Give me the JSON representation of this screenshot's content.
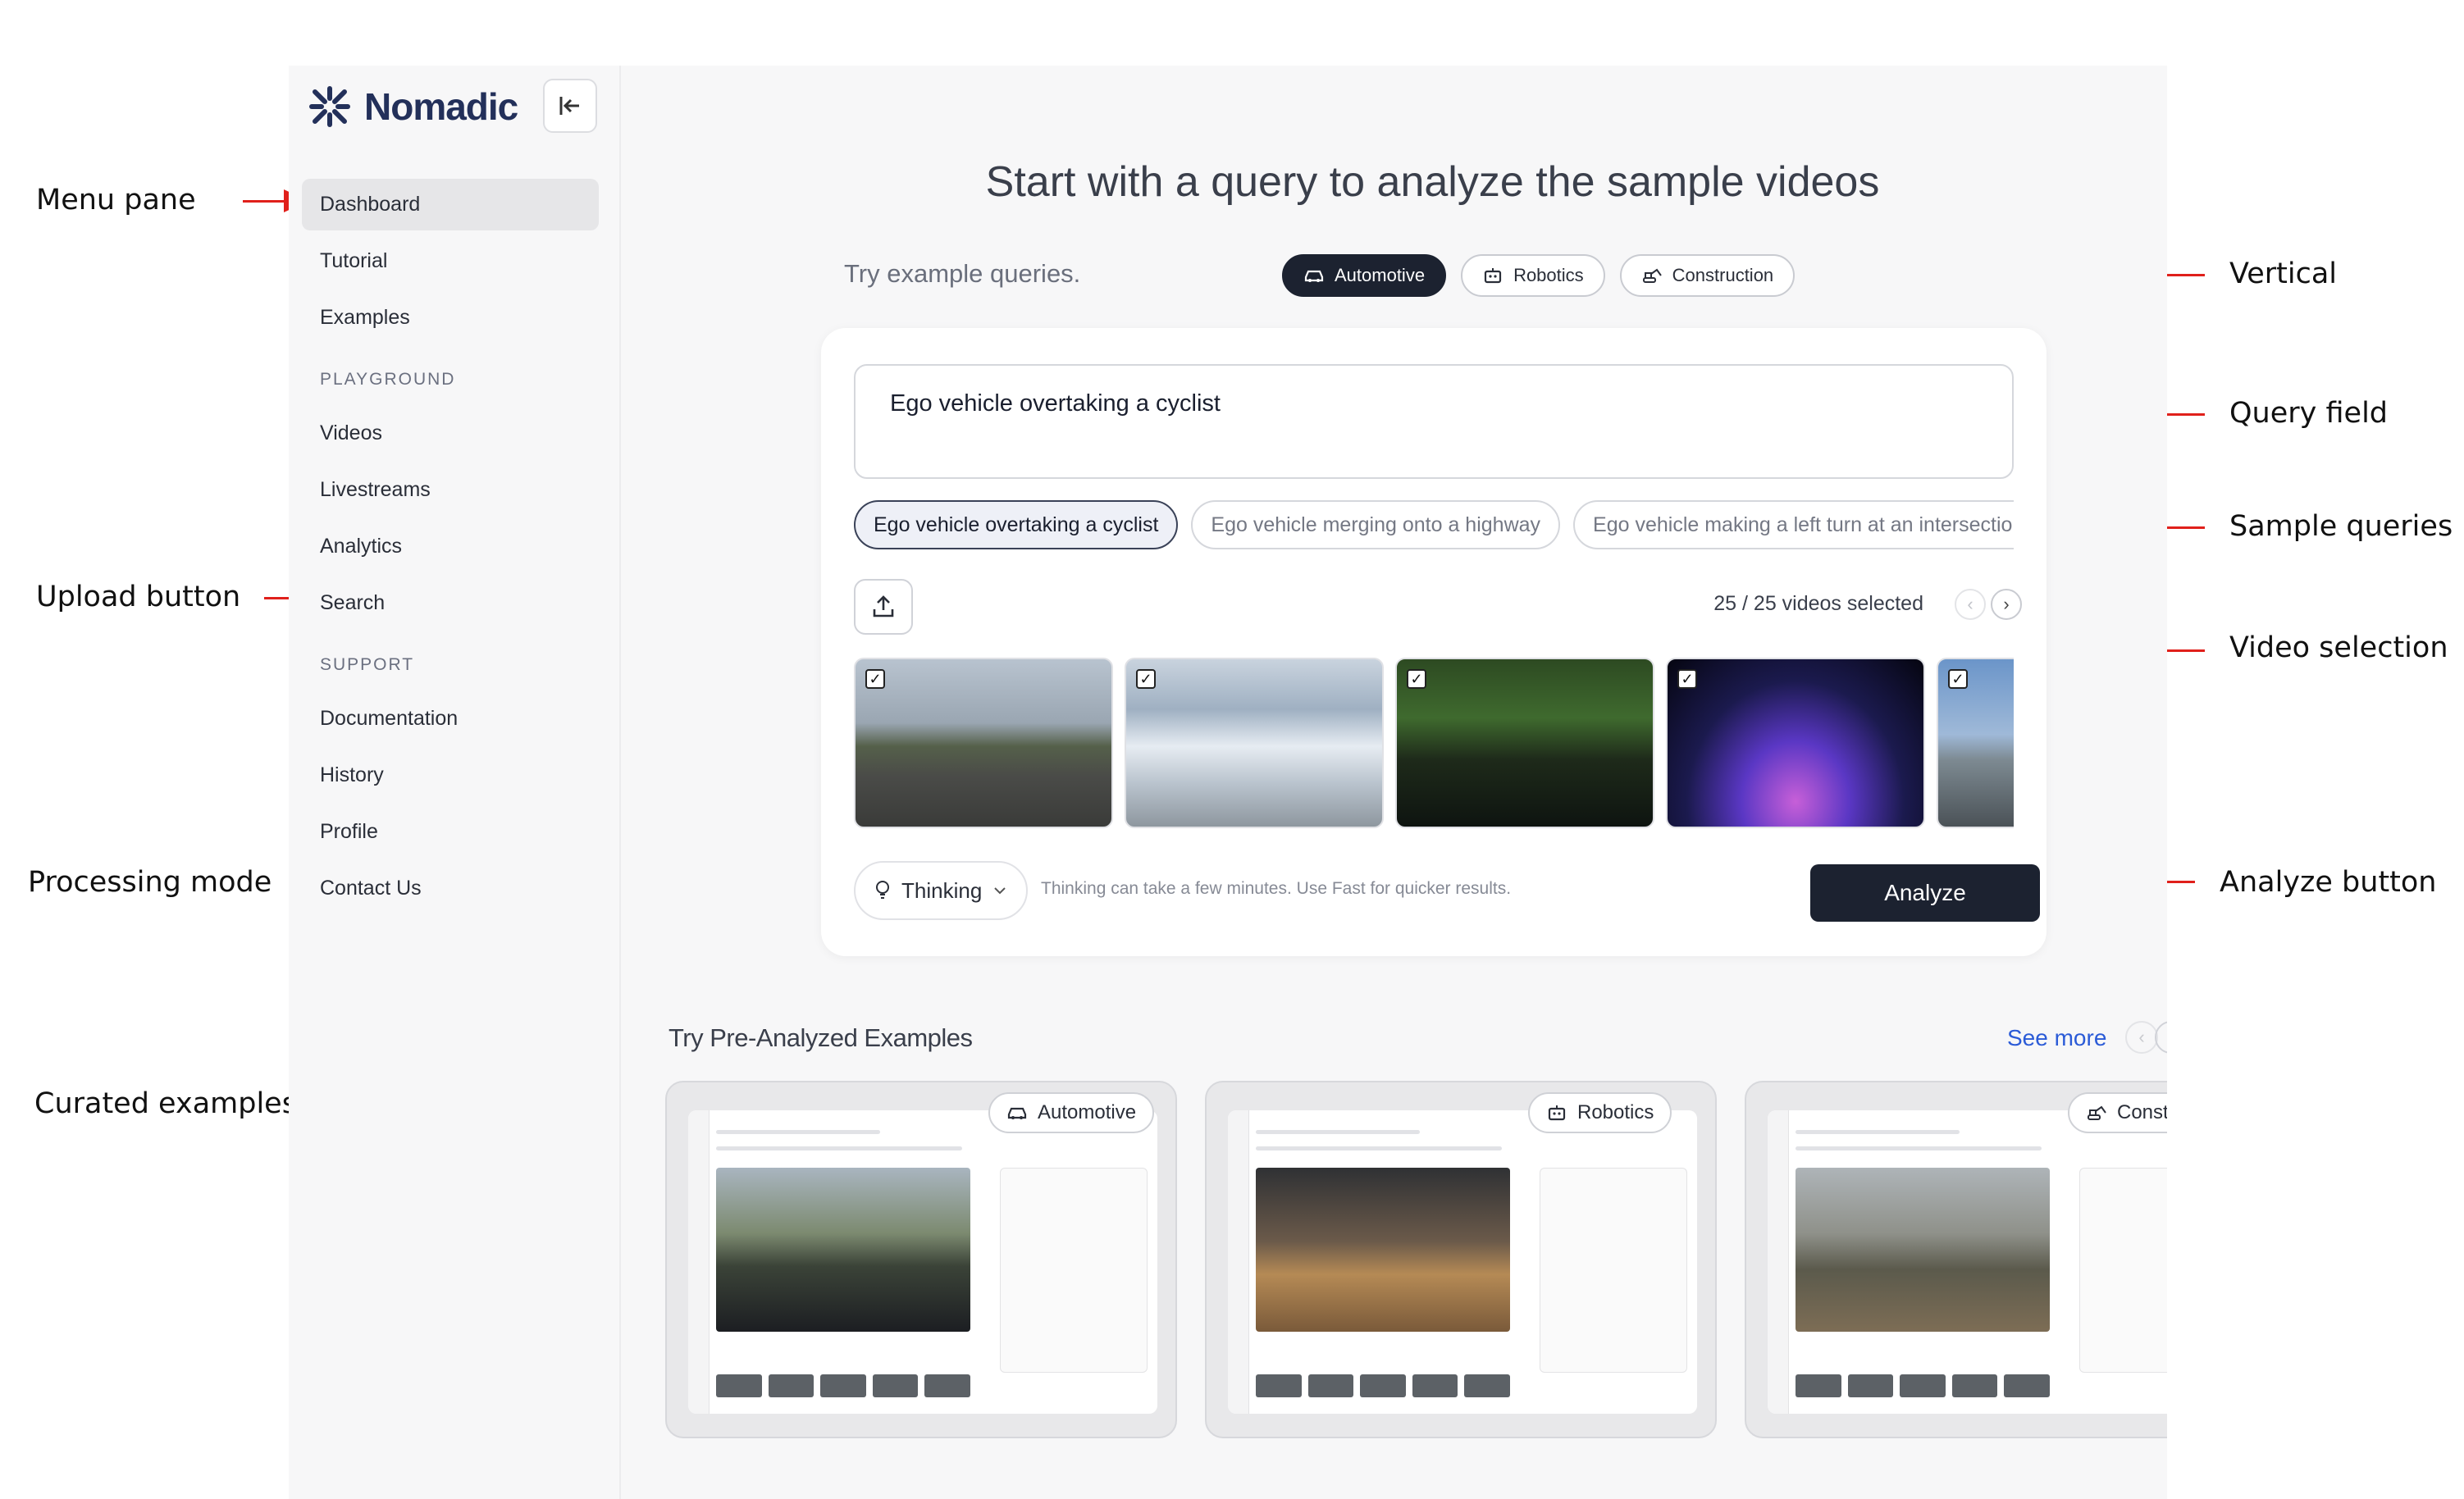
{
  "annotations": {
    "menu_pane": "Menu pane",
    "upload_button": "Upload button",
    "processing_mode": "Processing mode",
    "curated_examples": "Curated examples",
    "vertical": "Vertical",
    "query_field": "Query field",
    "sample_queries": "Sample queries",
    "video_selection": "Video selection",
    "analyze_button": "Analyze button"
  },
  "sidebar": {
    "brand": "Nomadic",
    "collapse_icon": "collapse-left-icon",
    "items": [
      {
        "label": "Dashboard",
        "active": true
      },
      {
        "label": "Tutorial"
      },
      {
        "label": "Examples"
      }
    ],
    "playground": {
      "heading": "PLAYGROUND",
      "items": [
        {
          "label": "Videos"
        },
        {
          "label": "Livestreams"
        },
        {
          "label": "Analytics"
        },
        {
          "label": "Search"
        }
      ]
    },
    "support": {
      "heading": "SUPPORT",
      "items": [
        {
          "label": "Documentation"
        },
        {
          "label": "History"
        },
        {
          "label": "Profile"
        },
        {
          "label": "Contact Us"
        }
      ]
    }
  },
  "main": {
    "title": "Start with a query to analyze the sample videos",
    "try_label": "Try example queries.",
    "verticals": [
      {
        "label": "Automotive",
        "icon": "car-icon",
        "active": true
      },
      {
        "label": "Robotics",
        "icon": "robot-icon"
      },
      {
        "label": "Construction",
        "icon": "excavator-icon"
      }
    ],
    "query": "Ego vehicle overtaking a cyclist",
    "sample_queries": [
      {
        "label": "Ego vehicle overtaking a cyclist",
        "active": true
      },
      {
        "label": "Ego vehicle merging onto a highway"
      },
      {
        "label": "Ego vehicle making a left turn at an intersection"
      }
    ],
    "upload_icon": "upload-icon",
    "selection_count": "25 / 25 videos selected",
    "videos": [
      {
        "checked": true
      },
      {
        "checked": true
      },
      {
        "checked": true
      },
      {
        "checked": true
      },
      {
        "checked": true
      }
    ],
    "mode": {
      "label": "Thinking",
      "icon": "lightbulb-icon",
      "hint": "Thinking can take a few minutes. Use Fast for quicker results."
    },
    "analyze_label": "Analyze"
  },
  "pre_analyzed": {
    "title": "Try Pre-Analyzed Examples",
    "see_more": "See more",
    "examples": [
      {
        "tag": "Automotive",
        "icon": "car-icon"
      },
      {
        "tag": "Robotics",
        "icon": "robot-icon"
      },
      {
        "tag": "Construction",
        "icon": "excavator-icon"
      }
    ]
  },
  "colors": {
    "accent_dark": "#1c2230",
    "link_blue": "#2b5bd7",
    "annotation_red": "#e0201b",
    "brand_navy": "#23305a"
  }
}
